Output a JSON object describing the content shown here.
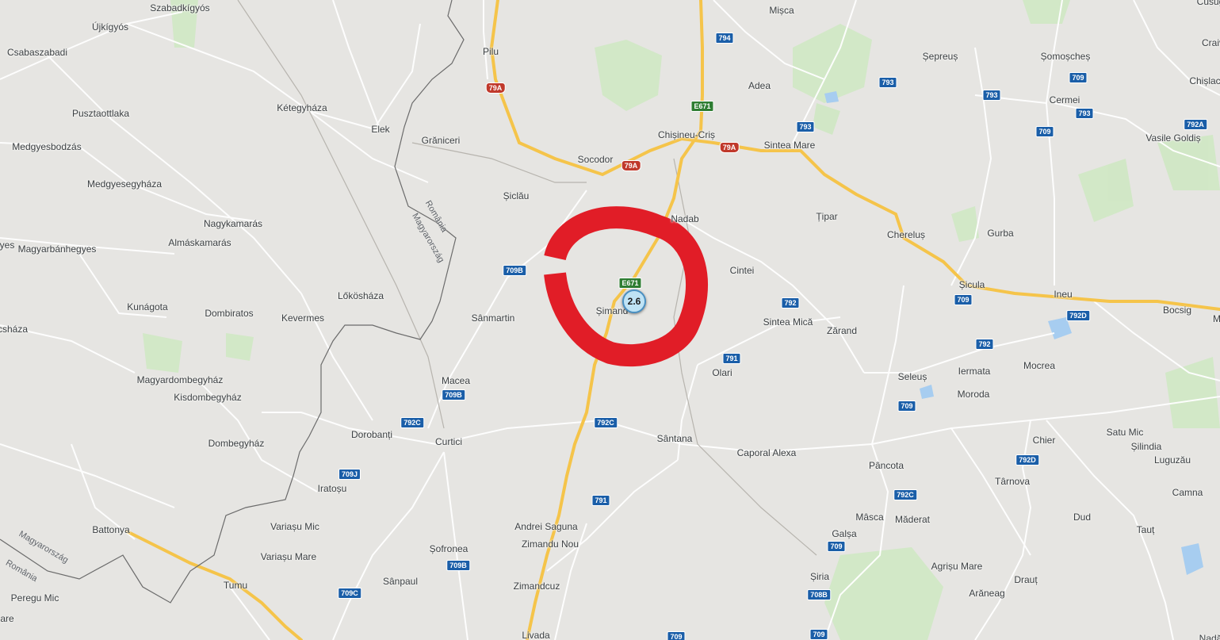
{
  "places": [
    {
      "name": "Szabadkígyós"
    },
    {
      "name": "Újkígyós"
    },
    {
      "name": "Csabaszabadi"
    },
    {
      "name": "Kétegyháza"
    },
    {
      "name": "Pusztaottlaka"
    },
    {
      "name": "Elek"
    },
    {
      "name": "Medgyesbodzás"
    },
    {
      "name": "Medgyesegyháza"
    },
    {
      "name": "Nagykamarás"
    },
    {
      "name": "Almáskamarás"
    },
    {
      "name": "yes"
    },
    {
      "name": "Magyarbánhegyes"
    },
    {
      "name": "Lőkösháza"
    },
    {
      "name": "Kunágota"
    },
    {
      "name": "Dombiratos"
    },
    {
      "name": "Kevermes"
    },
    {
      "name": "csháza"
    },
    {
      "name": "Magyardombegyház"
    },
    {
      "name": "Kisdombegyház"
    },
    {
      "name": "Dombegyház"
    },
    {
      "name": "Battonya"
    },
    {
      "name": "Tumu"
    },
    {
      "name": "Peregu Mic"
    },
    {
      "name": "are"
    },
    {
      "name": "Pilu"
    },
    {
      "name": "Grăniceri"
    },
    {
      "name": "Socodor"
    },
    {
      "name": "Șiclău"
    },
    {
      "name": "Sânmartin"
    },
    {
      "name": "Macea"
    },
    {
      "name": "Dorobanți"
    },
    {
      "name": "Curtici"
    },
    {
      "name": "Iratoșu"
    },
    {
      "name": "Variașu Mic"
    },
    {
      "name": "Variașu Mare"
    },
    {
      "name": "Șofronea"
    },
    {
      "name": "Sânpaul"
    },
    {
      "name": "Mișca"
    },
    {
      "name": "Adea"
    },
    {
      "name": "Chișineu-Criș"
    },
    {
      "name": "Sintea Mare"
    },
    {
      "name": "Nadab"
    },
    {
      "name": "Țipar"
    },
    {
      "name": "Cintei"
    },
    {
      "name": "Șimand"
    },
    {
      "name": "Sintea Mică"
    },
    {
      "name": "Zărand"
    },
    {
      "name": "Olari"
    },
    {
      "name": "Sântana"
    },
    {
      "name": "Caporal Alexa"
    },
    {
      "name": "Andrei Saguna"
    },
    {
      "name": "Zimandu Nou"
    },
    {
      "name": "Zimandcuz"
    },
    {
      "name": "Livada"
    },
    {
      "name": "Șepreuș"
    },
    {
      "name": "Șomoșcheș"
    },
    {
      "name": "Cermei"
    },
    {
      "name": "Chișlac"
    },
    {
      "name": "Vasile Goldiș"
    },
    {
      "name": "Chereluș"
    },
    {
      "name": "Gurba"
    },
    {
      "name": "Șicula"
    },
    {
      "name": "Ineu"
    },
    {
      "name": "Bocsig"
    },
    {
      "name": "Seleuș"
    },
    {
      "name": "Iermata"
    },
    {
      "name": "Mocrea"
    },
    {
      "name": "Moroda"
    },
    {
      "name": "Chier"
    },
    {
      "name": "Satu Mic"
    },
    {
      "name": "Șilindia"
    },
    {
      "name": "Luguzău"
    },
    {
      "name": "Pâncota"
    },
    {
      "name": "Târnova"
    },
    {
      "name": "Camna"
    },
    {
      "name": "Mâsca"
    },
    {
      "name": "Măderat"
    },
    {
      "name": "Dud"
    },
    {
      "name": "Tauț"
    },
    {
      "name": "Galșa"
    },
    {
      "name": "Agrișu Mare"
    },
    {
      "name": "Drauț"
    },
    {
      "name": "Șiria"
    },
    {
      "name": "Arăneag"
    },
    {
      "name": "Craiv"
    },
    {
      "name": "Cusug"
    },
    {
      "name": "Nadă"
    },
    {
      "name": "M"
    }
  ],
  "road_shields": [
    {
      "label": "794",
      "color": "blue"
    },
    {
      "label": "79A",
      "color": "red"
    },
    {
      "label": "79A",
      "color": "red"
    },
    {
      "label": "79A",
      "color": "red"
    },
    {
      "label": "E671",
      "color": "green"
    },
    {
      "label": "E671",
      "color": "green"
    },
    {
      "label": "793",
      "color": "blue"
    },
    {
      "label": "793",
      "color": "blue"
    },
    {
      "label": "793",
      "color": "blue"
    },
    {
      "label": "793",
      "color": "blue"
    },
    {
      "label": "709",
      "color": "blue"
    },
    {
      "label": "709",
      "color": "blue"
    },
    {
      "label": "709",
      "color": "blue"
    },
    {
      "label": "709",
      "color": "blue"
    },
    {
      "label": "709",
      "color": "blue"
    },
    {
      "label": "792A",
      "color": "blue"
    },
    {
      "label": "792D",
      "color": "blue"
    },
    {
      "label": "792",
      "color": "blue"
    },
    {
      "label": "792",
      "color": "blue"
    },
    {
      "label": "791",
      "color": "blue"
    },
    {
      "label": "791",
      "color": "blue"
    },
    {
      "label": "709B",
      "color": "blue"
    },
    {
      "label": "709B",
      "color": "blue"
    },
    {
      "label": "709B",
      "color": "blue"
    },
    {
      "label": "792C",
      "color": "blue"
    },
    {
      "label": "792C",
      "color": "blue"
    },
    {
      "label": "792C",
      "color": "blue"
    },
    {
      "label": "709J",
      "color": "blue"
    },
    {
      "label": "709C",
      "color": "blue"
    },
    {
      "label": "708B",
      "color": "blue"
    },
    {
      "label": "792D",
      "color": "blue"
    },
    {
      "label": "709",
      "color": "blue"
    },
    {
      "label": "709",
      "color": "blue"
    }
  ],
  "border_labels": [
    {
      "text": "România"
    },
    {
      "text": "Magyarország"
    },
    {
      "text": "Magyarország"
    },
    {
      "text": "România"
    }
  ],
  "marker": {
    "label": "2.6"
  },
  "colors": {
    "background": "#e6e5e2",
    "major_road": "#f6c744",
    "annotation_circle": "#e11d27",
    "border": "#616161",
    "park": "#c9e7be",
    "water": "#9fc6ec"
  }
}
